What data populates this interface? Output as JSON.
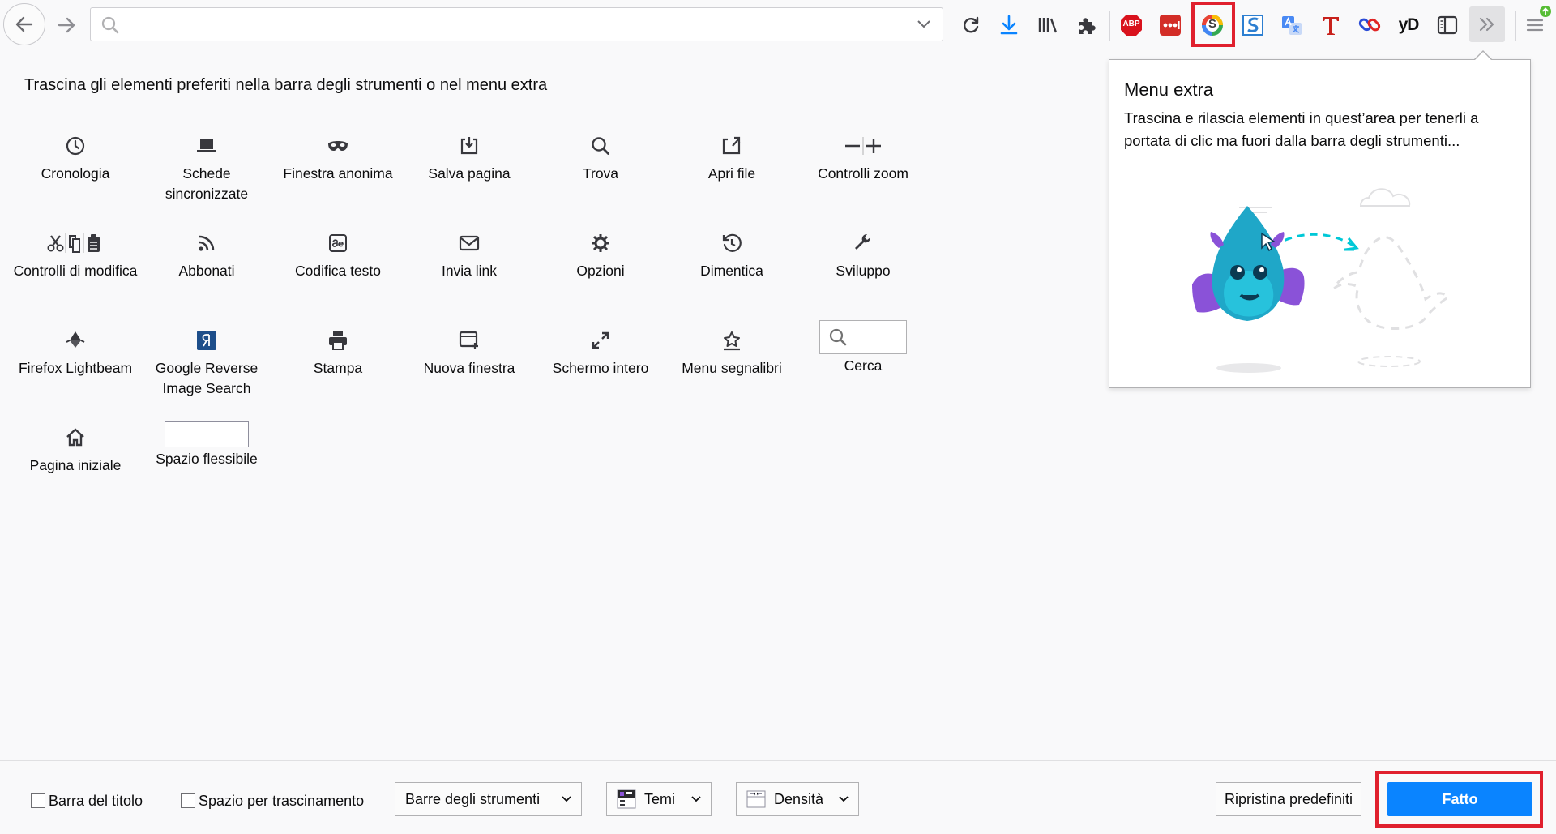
{
  "toolbar": {
    "urlbar_placeholder": "",
    "icons": [
      "back-arrow-icon",
      "forward-arrow-icon",
      "reload-icon",
      "download-icon",
      "library-icon",
      "extensions-icon",
      "adblock-plus-icon",
      "lastpass-icon",
      "scrapbook-icon",
      "scribe-icon",
      "translate-icon",
      "text-t-icon",
      "link-chain-icon",
      "yandex-icon",
      "sidebar-icon",
      "overflow-chevron-icon",
      "menu-hamburger-icon"
    ],
    "abp_label": "ABP",
    "yd_label": "yD",
    "s_label": "S"
  },
  "palette": {
    "title": "Trascina gli elementi preferiti nella barra degli strumenti o nel menu extra",
    "items": [
      {
        "label": "Cronologia",
        "icon": "clock-icon"
      },
      {
        "label": "Schede sincronizzate",
        "icon": "laptop-icon"
      },
      {
        "label": "Finestra anonima",
        "icon": "mask-icon"
      },
      {
        "label": "Salva pagina",
        "icon": "save-page-icon"
      },
      {
        "label": "Trova",
        "icon": "search-icon"
      },
      {
        "label": "Apri file",
        "icon": "open-file-icon"
      },
      {
        "label": "Controlli zoom",
        "icon": "zoom-controls-icon"
      },
      {
        "label": "Controlli di modifica",
        "icon": "edit-controls-icon"
      },
      {
        "label": "Abbonati",
        "icon": "rss-icon"
      },
      {
        "label": "Codifica testo",
        "icon": "text-encoding-icon"
      },
      {
        "label": "Invia link",
        "icon": "email-icon"
      },
      {
        "label": "Opzioni",
        "icon": "gear-icon"
      },
      {
        "label": "Dimentica",
        "icon": "forget-history-icon"
      },
      {
        "label": "Sviluppo",
        "icon": "wrench-icon"
      },
      {
        "label": "Firefox Lightbeam",
        "icon": "lightbeam-icon"
      },
      {
        "label": "Google Reverse Image Search",
        "icon": "reverse-image-icon"
      },
      {
        "label": "Stampa",
        "icon": "printer-icon"
      },
      {
        "label": "Nuova finestra",
        "icon": "new-window-icon"
      },
      {
        "label": "Schermo intero",
        "icon": "fullscreen-icon"
      },
      {
        "label": "Menu segnalibri",
        "icon": "bookmark-star-icon"
      },
      {
        "label": "Cerca",
        "icon": "search-widget"
      },
      {
        "label": "Pagina iniziale",
        "icon": "home-icon"
      },
      {
        "label": "Spazio flessibile",
        "icon": "flexible-space-widget"
      }
    ]
  },
  "overflow_panel": {
    "title": "Menu extra",
    "text": "Trascina e rilascia elementi in quest’area per tenerli a portata di clic ma fuori dalla barra degli strumenti..."
  },
  "footer": {
    "title_bar_label": "Barra del titolo",
    "drag_space_label": "Spazio per trascinamento",
    "toolbars_label": "Barre degli strumenti",
    "themes_label": "Temi",
    "density_label": "Densità",
    "restore_label": "Ripristina predefiniti",
    "done_label": "Fatto"
  },
  "colors": {
    "accent": "#0a84ff",
    "highlight": "#e0202e",
    "background": "#f9f9fa"
  }
}
